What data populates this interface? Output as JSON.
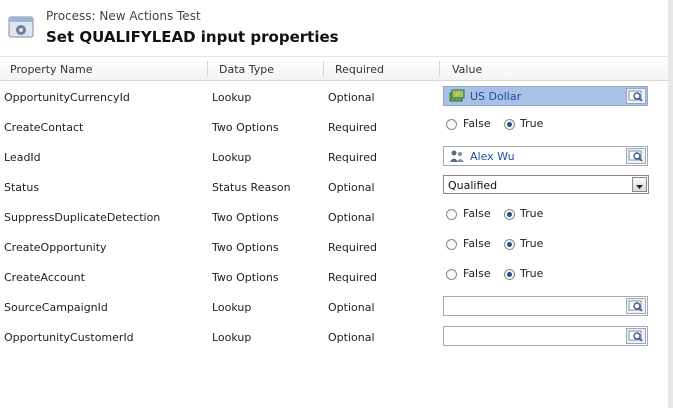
{
  "header": {
    "process_label": "Process: New Actions Test",
    "title": "Set QUALIFYLEAD input properties"
  },
  "columns": [
    "Property Name",
    "Data Type",
    "Required",
    "Value"
  ],
  "rows": [
    {
      "name": "OpportunityCurrencyId",
      "type": "Lookup",
      "required": "Optional",
      "value_kind": "lookup",
      "value": "US Dollar",
      "icon": "currency-icon"
    },
    {
      "name": "CreateContact",
      "type": "Two Options",
      "required": "Required",
      "value_kind": "radio",
      "false_label": "False",
      "true_label": "True",
      "selected": "True"
    },
    {
      "name": "LeadId",
      "type": "Lookup",
      "required": "Required",
      "value_kind": "lookup",
      "value": "Alex Wu",
      "icon": "lead-icon"
    },
    {
      "name": "Status",
      "type": "Status Reason",
      "required": "Optional",
      "value_kind": "select",
      "value": "Qualified"
    },
    {
      "name": "SuppressDuplicateDetection",
      "type": "Two Options",
      "required": "Optional",
      "value_kind": "radio",
      "false_label": "False",
      "true_label": "True",
      "selected": "True"
    },
    {
      "name": "CreateOpportunity",
      "type": "Two Options",
      "required": "Required",
      "value_kind": "radio",
      "false_label": "False",
      "true_label": "True",
      "selected": "True"
    },
    {
      "name": "CreateAccount",
      "type": "Two Options",
      "required": "Required",
      "value_kind": "radio",
      "false_label": "False",
      "true_label": "True",
      "selected": "True"
    },
    {
      "name": "SourceCampaignId",
      "type": "Lookup",
      "required": "Optional",
      "value_kind": "lookup",
      "value": ""
    },
    {
      "name": "OpportunityCustomerId",
      "type": "Lookup",
      "required": "Optional",
      "value_kind": "lookup",
      "value": ""
    }
  ],
  "colors": {
    "lookup_filled": "#a9c1e6",
    "link_text": "#1b4fa0",
    "radio_dot": "#2a4f86"
  }
}
